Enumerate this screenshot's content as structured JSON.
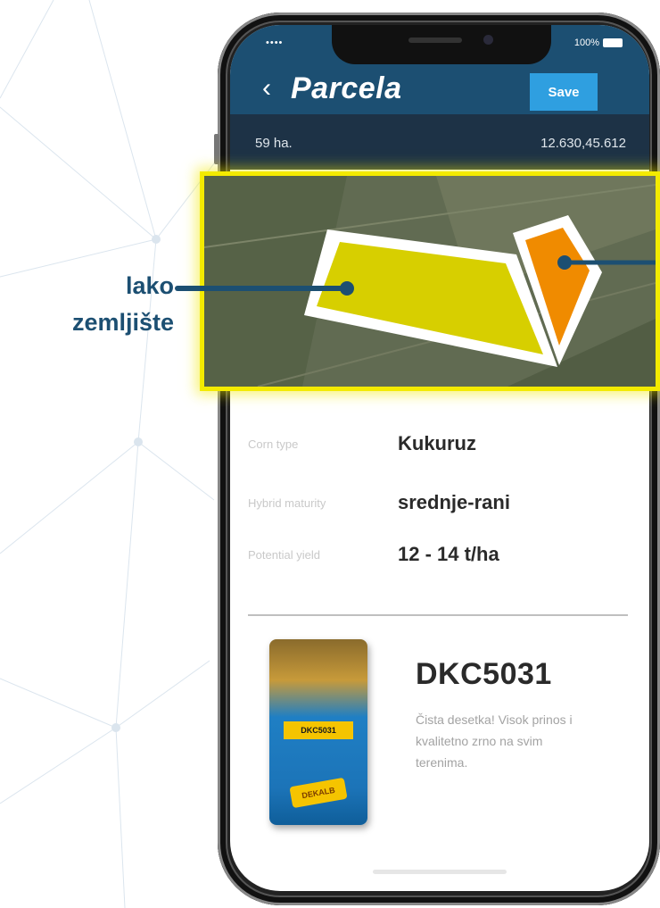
{
  "status_bar": {
    "signal": "•••• ",
    "battery": "100%"
  },
  "app_bar": {
    "back_icon": "chevron-left-icon",
    "title": "Parcela",
    "save_label": "Save"
  },
  "info_bar": {
    "area": "59 ha.",
    "coordinates": "12.630,45.612"
  },
  "fields": [
    {
      "label": "Corn type",
      "value": "Kukuruz"
    },
    {
      "label": "Hybrid maturity",
      "value": "srednje-rani"
    },
    {
      "label": "Potential yield",
      "value": "12 - 14 t/ha"
    }
  ],
  "product": {
    "name": "DKC5031",
    "bag_tag": "DKC5031",
    "bag_logo": "DEKALB",
    "description": "Čista desetka! Visok prinos i kvalitetno zrno na svim terenima."
  },
  "callout": {
    "line1": "lako",
    "line2": "zemljište"
  },
  "colors": {
    "app_bar": "#1c4f72",
    "info_bar": "#1d3246",
    "save_button": "#2f9fe0",
    "highlight": "#f3ea00",
    "parcel_yellow": "#d7cf00",
    "parcel_orange": "#f08b00",
    "callout": "#1c4f72"
  }
}
